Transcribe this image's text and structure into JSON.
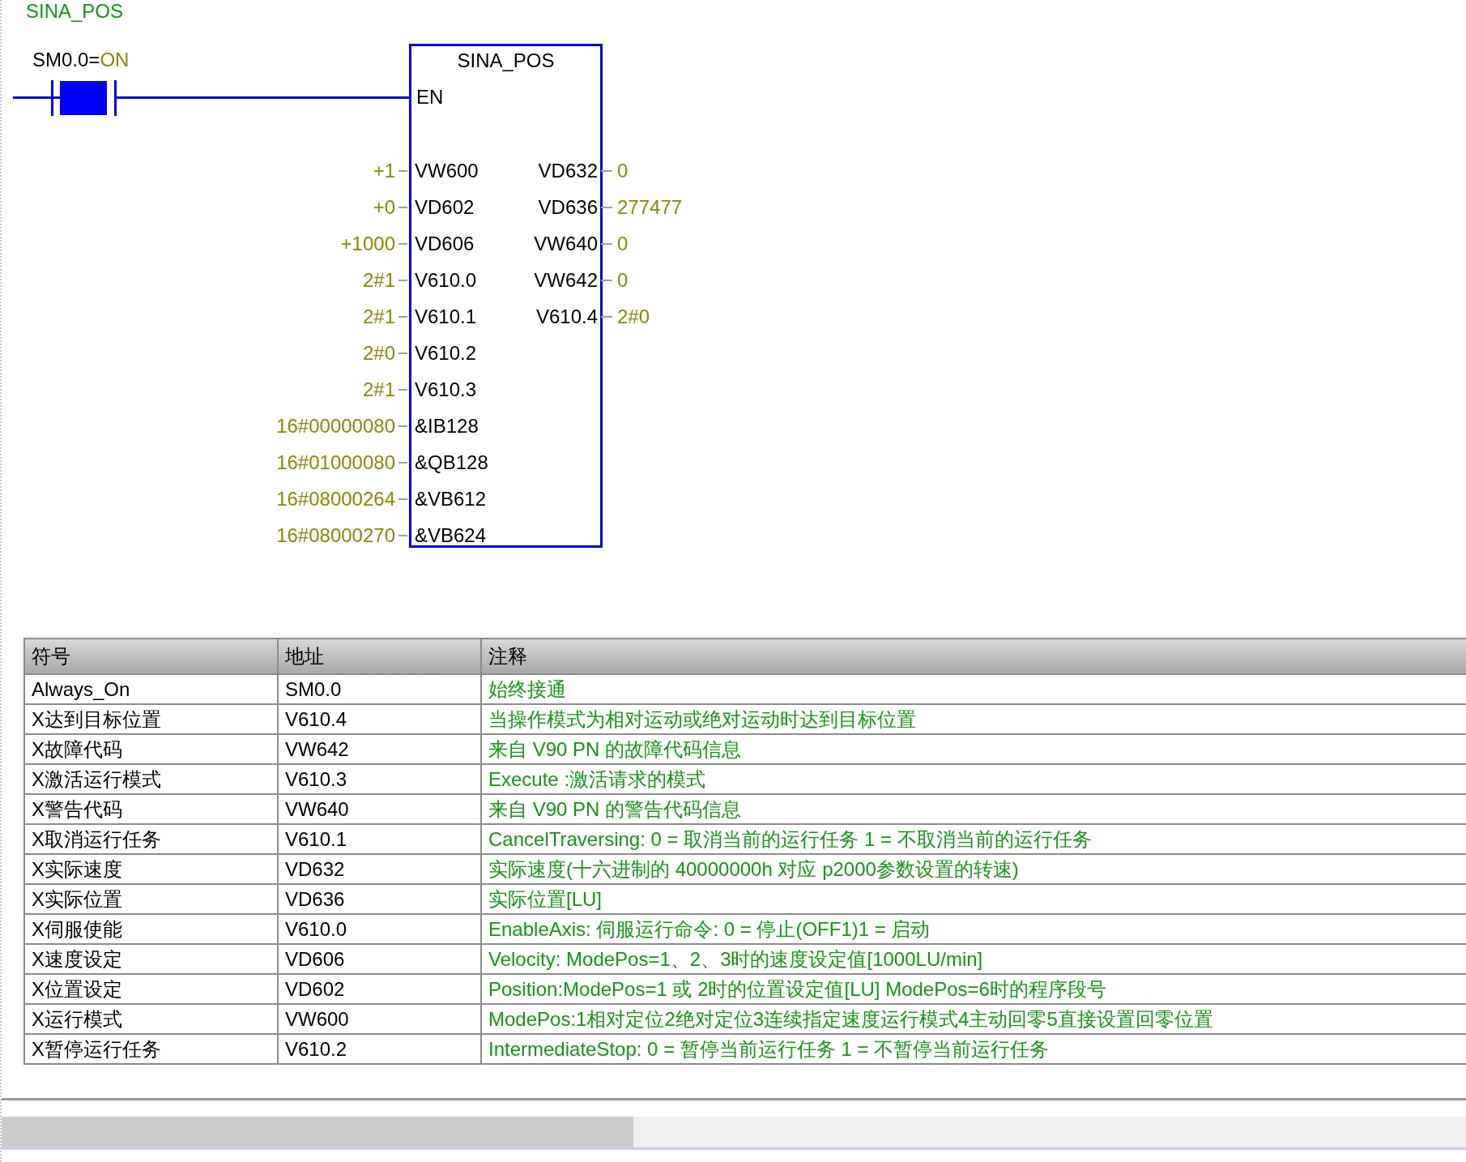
{
  "network_title": "SINA_POS",
  "contact": {
    "address": "SM0.0=",
    "value": "ON",
    "energized": true
  },
  "block": {
    "title": "SINA_POS",
    "enable_pin": "EN",
    "inputs": [
      {
        "value": "+1",
        "pin": "VW600"
      },
      {
        "value": "+0",
        "pin": "VD602"
      },
      {
        "value": "+1000",
        "pin": "VD606"
      },
      {
        "value": "2#1",
        "pin": "V610.0"
      },
      {
        "value": "2#1",
        "pin": "V610.1"
      },
      {
        "value": "2#0",
        "pin": "V610.2"
      },
      {
        "value": "2#1",
        "pin": "V610.3"
      },
      {
        "value": "16#00000080",
        "pin": "&IB128"
      },
      {
        "value": "16#01000080",
        "pin": "&QB128"
      },
      {
        "value": "16#08000264",
        "pin": "&VB612"
      },
      {
        "value": "16#08000270",
        "pin": "&VB624"
      }
    ],
    "outputs": [
      {
        "pin": "VD632",
        "value": "0"
      },
      {
        "pin": "VD636",
        "value": "277477"
      },
      {
        "pin": "VW640",
        "value": "0"
      },
      {
        "pin": "VW642",
        "value": "0"
      },
      {
        "pin": "V610.4",
        "value": "2#0"
      }
    ]
  },
  "symbol_table": {
    "columns": [
      "符号",
      "地址",
      "注释"
    ],
    "rows": [
      {
        "symbol": "Always_On",
        "address": "SM0.0",
        "comment": "始终接通"
      },
      {
        "symbol": "X达到目标位置",
        "address": "V610.4",
        "comment": "当操作模式为相对运动或绝对运动时达到目标位置"
      },
      {
        "symbol": "X故障代码",
        "address": "VW642",
        "comment": "来自 V90 PN 的故障代码信息"
      },
      {
        "symbol": "X激活运行模式",
        "address": "V610.3",
        "comment": "Execute :激活请求的模式"
      },
      {
        "symbol": "X警告代码",
        "address": "VW640",
        "comment": "来自 V90 PN 的警告代码信息"
      },
      {
        "symbol": "X取消运行任务",
        "address": "V610.1",
        "comment": "CancelTraversing: 0 = 取消当前的运行任务 1 = 不取消当前的运行任务"
      },
      {
        "symbol": "X实际速度",
        "address": "VD632",
        "comment": "实际速度(十六进制的 40000000h 对应 p2000参数设置的转速)"
      },
      {
        "symbol": "X实际位置",
        "address": "VD636",
        "comment": "实际位置[LU]"
      },
      {
        "symbol": "X伺服使能",
        "address": "V610.0",
        "comment": "EnableAxis: 伺服运行命令: 0 = 停止(OFF1)1 = 启动"
      },
      {
        "symbol": "X速度设定",
        "address": "VD606",
        "comment": "Velocity: ModePos=1、2、3时的速度设定值[1000LU/min]"
      },
      {
        "symbol": "X位置设定",
        "address": "VD602",
        "comment": "Position:ModePos=1 或 2时的位置设定值[LU] ModePos=6时的程序段号"
      },
      {
        "symbol": "X运行模式",
        "address": "VW600",
        "comment": "ModePos:1相对定位2绝对定位3连续指定速度运行模式4主动回零5直接设置回零位置"
      },
      {
        "symbol": "X暂停运行任务",
        "address": "V610.2",
        "comment": "IntermediateStop: 0 = 暂停当前运行任务 1 = 不暂停当前运行任务"
      }
    ]
  }
}
